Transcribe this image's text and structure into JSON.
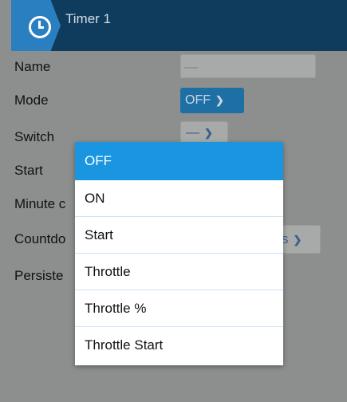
{
  "header": {
    "title": "Timer 1",
    "icon": "timer-icon"
  },
  "form": {
    "name_label": "Name",
    "name_value": "—",
    "mode_label": "Mode",
    "mode_value": "OFF",
    "switch_label": "Switch",
    "switch_value": "—",
    "start_label": "Start",
    "minute_label": "Minute c",
    "countdown_label": "Countdo",
    "countdown_value": "s",
    "persistent_label": "Persiste"
  },
  "dropdown": {
    "options": [
      "OFF",
      "ON",
      "Start",
      "Throttle",
      "Throttle %",
      "Throttle Start"
    ],
    "selected": "OFF"
  },
  "colors": {
    "header_bg": "#0f3b5c",
    "accent": "#1a95e0",
    "overlay_bg": "#8d8f8e"
  }
}
